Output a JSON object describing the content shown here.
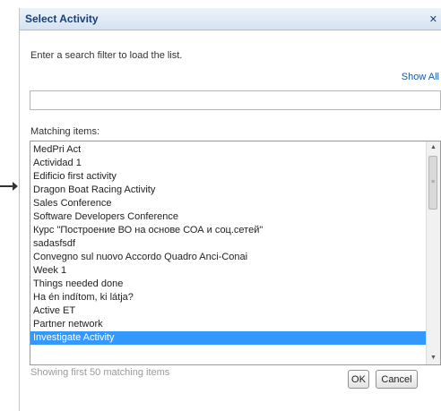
{
  "dialog": {
    "title": "Select Activity",
    "close_icon": "close-icon",
    "instruction": "Enter a search filter to load the list.",
    "show_all": "Show All",
    "search": {
      "value": "",
      "placeholder": ""
    },
    "matching_label": "Matching items:",
    "items": [
      {
        "label": "MedPri Act",
        "selected": false
      },
      {
        "label": "Actividad 1",
        "selected": false
      },
      {
        "label": "Edificio first activity",
        "selected": false
      },
      {
        "label": "Dragon Boat Racing Activity",
        "selected": false
      },
      {
        "label": "Sales Conference",
        "selected": false
      },
      {
        "label": "Software Developers Conference",
        "selected": false
      },
      {
        "label": "Курс \"Построение ВО на основе СОА и соц.сетей\"",
        "selected": false
      },
      {
        "label": "sadasfsdf",
        "selected": false
      },
      {
        "label": "Convegno sul nuovo Accordo Quadro Anci-Conai",
        "selected": false
      },
      {
        "label": "Week 1",
        "selected": false
      },
      {
        "label": "Things needed done",
        "selected": false
      },
      {
        "label": "Ha én indítom, ki látja?",
        "selected": false
      },
      {
        "label": "Active ET",
        "selected": false
      },
      {
        "label": "Partner network",
        "selected": false
      },
      {
        "label": "Investigate Activity",
        "selected": true
      }
    ],
    "status": "Showing first 50 matching items",
    "ok_label": "OK",
    "cancel_label": "Cancel",
    "colors": {
      "selection": "#3399ff",
      "title_text": "#15407a",
      "link": "#1a5aa6"
    }
  }
}
